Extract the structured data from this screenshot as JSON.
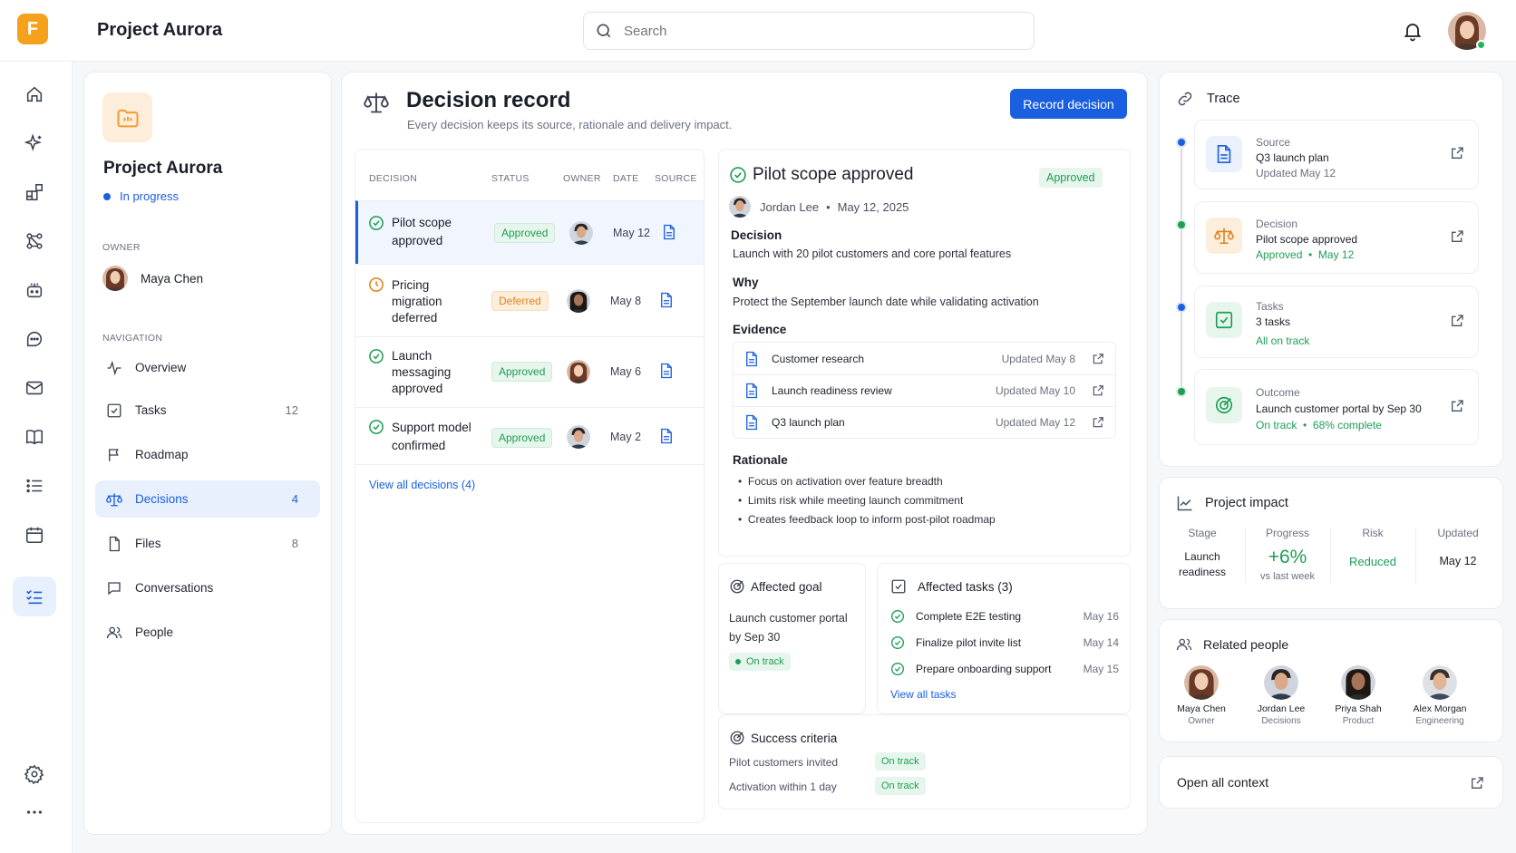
{
  "app": {
    "logo_letter": "F",
    "title": "Project Aurora"
  },
  "search": {
    "placeholder": "Search"
  },
  "icons": {
    "notifications": "bell-icon",
    "rail": [
      "home-icon",
      "sparkle-icon",
      "widgets-icon",
      "workflow-icon",
      "bot-icon",
      "chat-icon",
      "mail-icon",
      "book-icon",
      "list-icon",
      "calendar-icon",
      "checklist-icon",
      "gear-icon",
      "more-icon"
    ]
  },
  "colors": {
    "accent": "#1a5fe0",
    "logo": "#f5a11c",
    "success": "#1f9d55",
    "warning": "#e0801c"
  },
  "project": {
    "name": "Project Aurora",
    "status": "In progress",
    "owner_label": "OWNER",
    "owner_name": "Maya Chen",
    "nav_label": "NAVIGATION",
    "nav": [
      {
        "label": "Overview",
        "count": ""
      },
      {
        "label": "Tasks",
        "count": "12"
      },
      {
        "label": "Roadmap",
        "count": ""
      },
      {
        "label": "Decisions",
        "count": "4"
      },
      {
        "label": "Files",
        "count": "8"
      },
      {
        "label": "Conversations",
        "count": ""
      },
      {
        "label": "People",
        "count": ""
      }
    ]
  },
  "record": {
    "title": "Decision record",
    "subtitle": "Every decision keeps its source, rationale and delivery impact.",
    "button": "Record decision",
    "columns": {
      "decision": "DECISION",
      "status": "STATUS",
      "owner": "OWNER",
      "date": "DATE",
      "source": "SOURCE"
    },
    "decisions": [
      {
        "title_lines": [
          "Pilot scope",
          "approved"
        ],
        "status": "Approved",
        "date": "May 12"
      },
      {
        "title_lines": [
          "Pricing",
          "migration",
          "deferred"
        ],
        "status": "Deferred",
        "date": "May 8"
      },
      {
        "title_lines": [
          "Launch",
          "messaging",
          "approved"
        ],
        "status": "Approved",
        "date": "May 6"
      },
      {
        "title_lines": [
          "Support model",
          "confirmed"
        ],
        "status": "Approved",
        "date": "May 2"
      }
    ],
    "view_all": "View all decisions (4)"
  },
  "detail": {
    "title": "Pilot scope approved",
    "status": "Approved",
    "author": "Jordan Lee",
    "date": "May 12, 2025",
    "decision_label": "Decision",
    "decision_text": "Launch with 20 pilot customers and core portal features",
    "why_label": "Why",
    "why_text": "Protect the September launch date while validating activation",
    "evidence_label": "Evidence",
    "evidence": [
      {
        "name": "Customer research",
        "updated": "Updated May 8"
      },
      {
        "name": "Launch readiness review",
        "updated": "Updated May 10"
      },
      {
        "name": "Q3 launch plan",
        "updated": "Updated May 12"
      }
    ],
    "rationale_label": "Rationale",
    "rationale": [
      "Focus on activation over feature breadth",
      "Limits risk while meeting launch commitment",
      "Creates feedback loop to inform post-pilot roadmap"
    ]
  },
  "goal": {
    "label": "Affected goal",
    "text_lines": [
      "Launch customer portal",
      "by Sep 30"
    ],
    "status": "On track"
  },
  "tasks": {
    "label": "Affected tasks (3)",
    "items": [
      {
        "name": "Complete E2E testing",
        "date": "May 16"
      },
      {
        "name": "Finalize pilot invite list",
        "date": "May 14"
      },
      {
        "name": "Prepare onboarding support",
        "date": "May 15"
      }
    ],
    "view_all": "View all tasks"
  },
  "criteria": {
    "label": "Success criteria",
    "items": [
      {
        "name": "Pilot customers invited",
        "status": "On track"
      },
      {
        "name": "Activation within 1 day",
        "status": "On track"
      }
    ]
  },
  "trace": {
    "label": "Trace",
    "items": [
      {
        "kind": "Source",
        "title": "Q3 launch plan",
        "meta": "Updated May 12",
        "meta2": ""
      },
      {
        "kind": "Decision",
        "title": "Pilot scope approved",
        "meta": "Approved",
        "meta2": "May 12"
      },
      {
        "kind": "Tasks",
        "title": "3 tasks",
        "meta": "All on track",
        "meta2": ""
      },
      {
        "kind": "Outcome",
        "title": "Launch customer portal by Sep 30",
        "meta": "On track",
        "meta2": "68% complete"
      }
    ]
  },
  "impact": {
    "label": "Project impact",
    "stage_label": "Stage",
    "stage_value_lines": [
      "Launch",
      "readiness"
    ],
    "progress_label": "Progress",
    "progress_value": "+6%",
    "progress_sub": "vs last week",
    "risk_label": "Risk",
    "risk_value": "Reduced",
    "updated_label": "Updated",
    "updated_value": "May 12"
  },
  "people": {
    "label": "Related people",
    "items": [
      {
        "name": "Maya Chen",
        "role": "Owner"
      },
      {
        "name": "Jordan Lee",
        "role": "Decisions"
      },
      {
        "name": "Priya Shah",
        "role": "Product"
      },
      {
        "name": "Alex Morgan",
        "role": "Engineering"
      }
    ]
  },
  "context": {
    "label": "Open all context"
  }
}
